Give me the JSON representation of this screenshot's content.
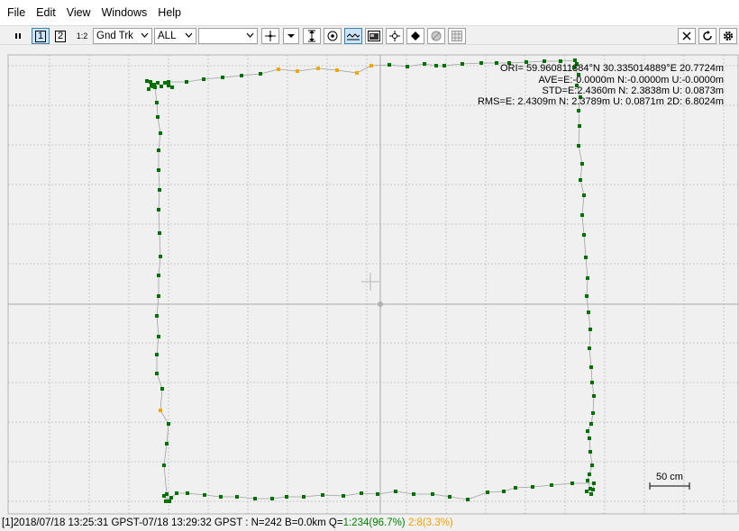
{
  "menu": {
    "file": "File",
    "edit": "Edit",
    "view": "View",
    "windows": "Windows",
    "help": "Help"
  },
  "toolbar": {
    "btn_one": "1",
    "btn_two": "2",
    "btn_one_two": "1:2",
    "plot_type": "Gnd Trk",
    "sat_filter": "ALL",
    "extra_select": "",
    "icons": [
      "pause-icon",
      "crosshair-icon",
      "dropdown-arrow-icon",
      "vertical-range-icon",
      "center-origin-icon",
      "track-line-icon",
      "map-image-icon",
      "point-icon",
      "mark-icon",
      "sky-icon",
      "grid-icon",
      "close-icon",
      "reload-icon",
      "settings-icon"
    ]
  },
  "plot": {
    "info_lines": [
      "ORI= 59.960811384°N  30.335014889°E 20.7724m",
      "AVE=E:-0.0000m N:-0.0000m U:-0.0000m",
      "STD=E:2.4360m N: 2.3838m U: 0.0873m",
      "RMS=E: 2.4309m N: 2.3789m U: 0.0871m 2D: 6.8024m"
    ],
    "scale_label": "50 cm",
    "colors": {
      "fix": "#007000",
      "float": "#f0a800",
      "grid": "#c8c8c8",
      "axis": "#a8a8a8",
      "line": "#a0a0a0"
    }
  },
  "status": {
    "prefix": "[1]2018/07/18 13:25:31 GPST-07/18 13:29:32 GPST : N=242 B=0.0km Q=",
    "q1": "1:234(96.7%)",
    "q2": "2:8(3.3%)"
  }
}
